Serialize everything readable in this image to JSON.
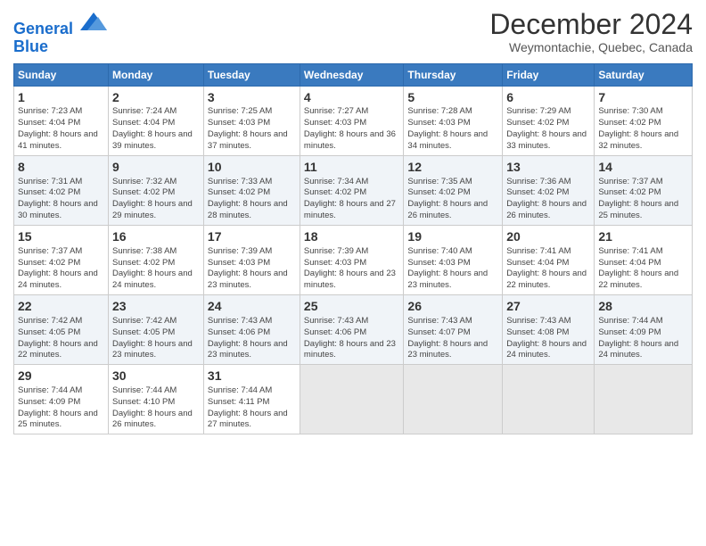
{
  "logo": {
    "line1": "General",
    "line2": "Blue"
  },
  "title": "December 2024",
  "subtitle": "Weymontachie, Quebec, Canada",
  "headers": [
    "Sunday",
    "Monday",
    "Tuesday",
    "Wednesday",
    "Thursday",
    "Friday",
    "Saturday"
  ],
  "weeks": [
    [
      {
        "day": "1",
        "sunrise": "7:23 AM",
        "sunset": "4:04 PM",
        "daylight": "8 hours and 41 minutes."
      },
      {
        "day": "2",
        "sunrise": "7:24 AM",
        "sunset": "4:04 PM",
        "daylight": "8 hours and 39 minutes."
      },
      {
        "day": "3",
        "sunrise": "7:25 AM",
        "sunset": "4:03 PM",
        "daylight": "8 hours and 37 minutes."
      },
      {
        "day": "4",
        "sunrise": "7:27 AM",
        "sunset": "4:03 PM",
        "daylight": "8 hours and 36 minutes."
      },
      {
        "day": "5",
        "sunrise": "7:28 AM",
        "sunset": "4:03 PM",
        "daylight": "8 hours and 34 minutes."
      },
      {
        "day": "6",
        "sunrise": "7:29 AM",
        "sunset": "4:02 PM",
        "daylight": "8 hours and 33 minutes."
      },
      {
        "day": "7",
        "sunrise": "7:30 AM",
        "sunset": "4:02 PM",
        "daylight": "8 hours and 32 minutes."
      }
    ],
    [
      {
        "day": "8",
        "sunrise": "7:31 AM",
        "sunset": "4:02 PM",
        "daylight": "8 hours and 30 minutes."
      },
      {
        "day": "9",
        "sunrise": "7:32 AM",
        "sunset": "4:02 PM",
        "daylight": "8 hours and 29 minutes."
      },
      {
        "day": "10",
        "sunrise": "7:33 AM",
        "sunset": "4:02 PM",
        "daylight": "8 hours and 28 minutes."
      },
      {
        "day": "11",
        "sunrise": "7:34 AM",
        "sunset": "4:02 PM",
        "daylight": "8 hours and 27 minutes."
      },
      {
        "day": "12",
        "sunrise": "7:35 AM",
        "sunset": "4:02 PM",
        "daylight": "8 hours and 26 minutes."
      },
      {
        "day": "13",
        "sunrise": "7:36 AM",
        "sunset": "4:02 PM",
        "daylight": "8 hours and 26 minutes."
      },
      {
        "day": "14",
        "sunrise": "7:37 AM",
        "sunset": "4:02 PM",
        "daylight": "8 hours and 25 minutes."
      }
    ],
    [
      {
        "day": "15",
        "sunrise": "7:37 AM",
        "sunset": "4:02 PM",
        "daylight": "8 hours and 24 minutes."
      },
      {
        "day": "16",
        "sunrise": "7:38 AM",
        "sunset": "4:02 PM",
        "daylight": "8 hours and 24 minutes."
      },
      {
        "day": "17",
        "sunrise": "7:39 AM",
        "sunset": "4:03 PM",
        "daylight": "8 hours and 23 minutes."
      },
      {
        "day": "18",
        "sunrise": "7:39 AM",
        "sunset": "4:03 PM",
        "daylight": "8 hours and 23 minutes."
      },
      {
        "day": "19",
        "sunrise": "7:40 AM",
        "sunset": "4:03 PM",
        "daylight": "8 hours and 23 minutes."
      },
      {
        "day": "20",
        "sunrise": "7:41 AM",
        "sunset": "4:04 PM",
        "daylight": "8 hours and 22 minutes."
      },
      {
        "day": "21",
        "sunrise": "7:41 AM",
        "sunset": "4:04 PM",
        "daylight": "8 hours and 22 minutes."
      }
    ],
    [
      {
        "day": "22",
        "sunrise": "7:42 AM",
        "sunset": "4:05 PM",
        "daylight": "8 hours and 22 minutes."
      },
      {
        "day": "23",
        "sunrise": "7:42 AM",
        "sunset": "4:05 PM",
        "daylight": "8 hours and 23 minutes."
      },
      {
        "day": "24",
        "sunrise": "7:43 AM",
        "sunset": "4:06 PM",
        "daylight": "8 hours and 23 minutes."
      },
      {
        "day": "25",
        "sunrise": "7:43 AM",
        "sunset": "4:06 PM",
        "daylight": "8 hours and 23 minutes."
      },
      {
        "day": "26",
        "sunrise": "7:43 AM",
        "sunset": "4:07 PM",
        "daylight": "8 hours and 23 minutes."
      },
      {
        "day": "27",
        "sunrise": "7:43 AM",
        "sunset": "4:08 PM",
        "daylight": "8 hours and 24 minutes."
      },
      {
        "day": "28",
        "sunrise": "7:44 AM",
        "sunset": "4:09 PM",
        "daylight": "8 hours and 24 minutes."
      }
    ],
    [
      {
        "day": "29",
        "sunrise": "7:44 AM",
        "sunset": "4:09 PM",
        "daylight": "8 hours and 25 minutes."
      },
      {
        "day": "30",
        "sunrise": "7:44 AM",
        "sunset": "4:10 PM",
        "daylight": "8 hours and 26 minutes."
      },
      {
        "day": "31",
        "sunrise": "7:44 AM",
        "sunset": "4:11 PM",
        "daylight": "8 hours and 27 minutes."
      },
      null,
      null,
      null,
      null
    ]
  ]
}
